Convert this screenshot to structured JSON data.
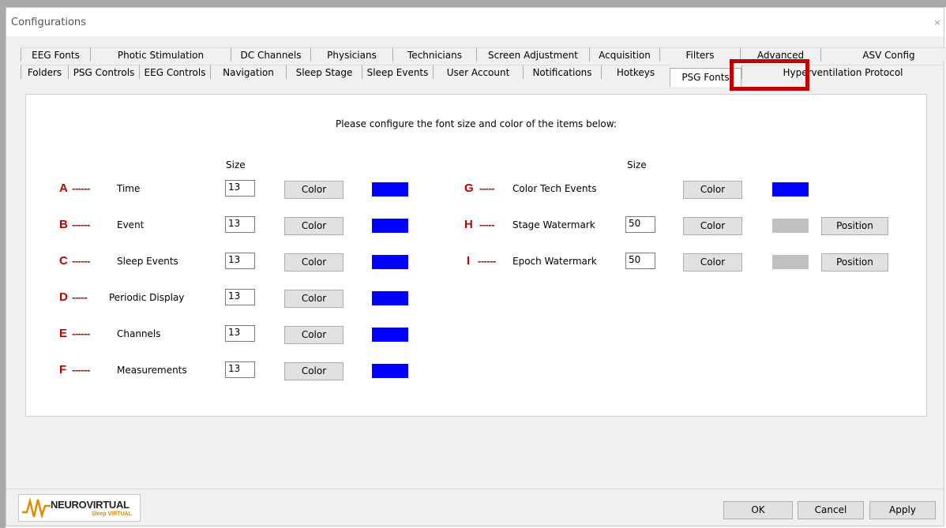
{
  "window": {
    "title": "Configurations",
    "close_glyph": "×"
  },
  "tabs_row1": [
    "EEG Fonts",
    "Photic Stimulation",
    "DC Channels",
    "Physicians",
    "Technicians",
    "Screen Adjustment",
    "Acquisition",
    "Filters",
    "Advanced",
    "ASV Config"
  ],
  "tabs_row2": [
    "Folders",
    "PSG Controls",
    "EEG Controls",
    "Navigation",
    "Sleep Stage",
    "Sleep Events",
    "User Account",
    "Notifications",
    "Hotkeys",
    "PSG Fonts",
    "Hyperventilation Protocol"
  ],
  "active_tab": "PSG Fonts",
  "instruction": "Please configure the font size and color of the items below:",
  "size_header": "Size",
  "color_label": "Color",
  "position_label": "Position",
  "left_items": [
    {
      "letter": "A",
      "dashes": "------",
      "label": "Time",
      "size": "13",
      "color": "#0000ff"
    },
    {
      "letter": "B",
      "dashes": "------",
      "label": "Event",
      "size": "13",
      "color": "#0000ff"
    },
    {
      "letter": "C",
      "dashes": "------",
      "label": "Sleep Events",
      "size": "13",
      "color": "#0000ff"
    },
    {
      "letter": "D",
      "dashes": "-----",
      "label": "Periodic Display",
      "size": "13",
      "color": "#0000ff"
    },
    {
      "letter": "E",
      "dashes": "------",
      "label": "Channels",
      "size": "13",
      "color": "#0000ff"
    },
    {
      "letter": "F",
      "dashes": "------",
      "label": "Measurements",
      "size": "13",
      "color": "#0000ff"
    }
  ],
  "right_items": [
    {
      "letter": "G",
      "dashes": "-----",
      "label": "Color Tech Events",
      "size": null,
      "color": "#0000ff",
      "has_position": false
    },
    {
      "letter": "H",
      "dashes": "-----",
      "label": "Stage Watermark",
      "size": "50",
      "color": "#c0c0c0",
      "has_position": true
    },
    {
      "letter": "I",
      "dashes": "------",
      "label": "Epoch Watermark",
      "size": "50",
      "color": "#c0c0c0",
      "has_position": true
    }
  ],
  "footer": {
    "ok": "OK",
    "cancel": "Cancel",
    "apply": "Apply",
    "logo_main": "NEUROVIRTUAL",
    "logo_sub": "Sleep VIRTUAL"
  },
  "colors": {
    "highlight": "#c00000",
    "annotation": "#c00000",
    "swatch_blue": "#0000ff",
    "swatch_gray": "#c0c0c0"
  }
}
